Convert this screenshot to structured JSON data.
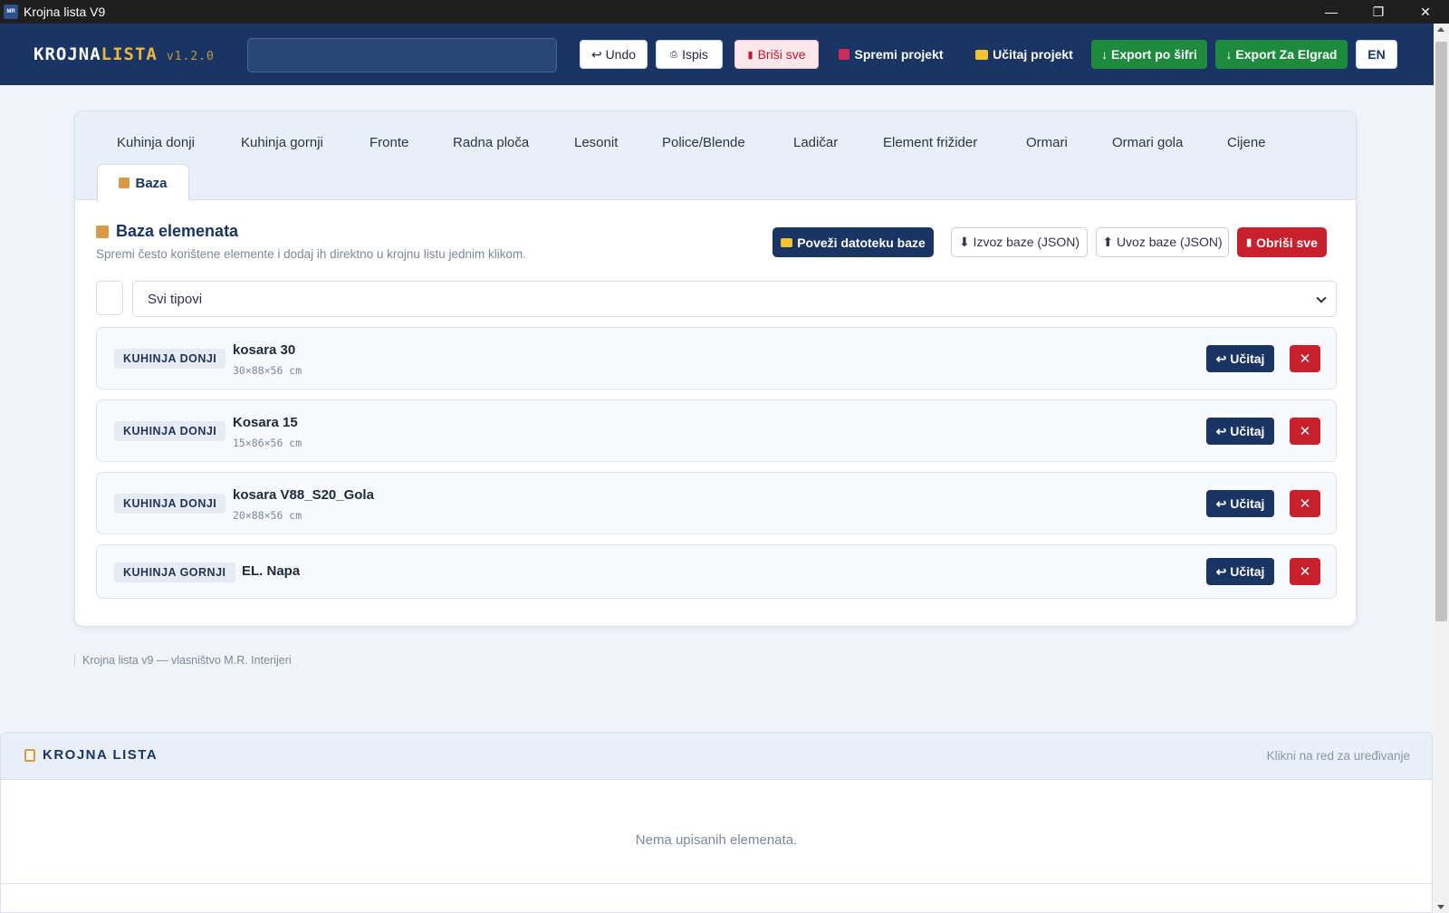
{
  "window": {
    "title": "Krojna lista V9",
    "icon_label": "MR"
  },
  "header": {
    "logo_main": "KROJNA",
    "logo_accent": "LISTA",
    "version": "v1.2.0",
    "search_placeholder": "",
    "buttons": {
      "undo": "↩ Undo",
      "print": "Ispis",
      "delete_all": "Briši sve",
      "save_project": "Spremi projekt",
      "load_project": "Učitaj projekt",
      "export_code": "↓ Export po šifri",
      "export_elgrad": "↓ Export Za Elgrad",
      "lang": "EN"
    }
  },
  "tabs": [
    "Kuhinja donji",
    "Kuhinja gornji",
    "Fronte",
    "Radna ploča",
    "Lesonit",
    "Police/Blende",
    "Ladičar",
    "Element frižider",
    "Ormari",
    "Ormari gola",
    "Cijene"
  ],
  "active_tab": "Baza",
  "baza": {
    "title": "Baza elemenata",
    "subtitle": "Spremi često korištene elemente i dodaj ih direktno u krojnu listu jednim klikom.",
    "buttons": {
      "link_file": "Poveži datoteku baze",
      "export_json": "⬇ Izvoz baze (JSON)",
      "import_json": "⬆ Uvoz baze (JSON)",
      "delete_all": "Obriši sve"
    },
    "filter_selected": "Svi tipovi",
    "items": [
      {
        "type": "KUHINJA DONJI",
        "name": "kosara 30",
        "dims": "30×88×56 cm"
      },
      {
        "type": "KUHINJA DONJI",
        "name": "Kosara 15",
        "dims": "15×86×56 cm"
      },
      {
        "type": "KUHINJA DONJI",
        "name": "kosara V88_S20_Gola",
        "dims": "20×88×56 cm"
      },
      {
        "type": "KUHINJA GORNJI",
        "name": "EL. Napa",
        "dims": ""
      }
    ],
    "load_label": "Učitaj",
    "delete_glyph": "✕"
  },
  "footer": "Krojna lista v9 — vlasništvo M.R. Interijeri",
  "krojna_lista": {
    "title": "KROJNA LISTA",
    "hint": "Klikni na red za uređivanje",
    "empty": "Nema upisanih elemenata."
  },
  "colors": {
    "navy": "#1a3463",
    "accent_gold": "#e9b640",
    "green": "#1e8a3d",
    "red": "#c8202c"
  }
}
